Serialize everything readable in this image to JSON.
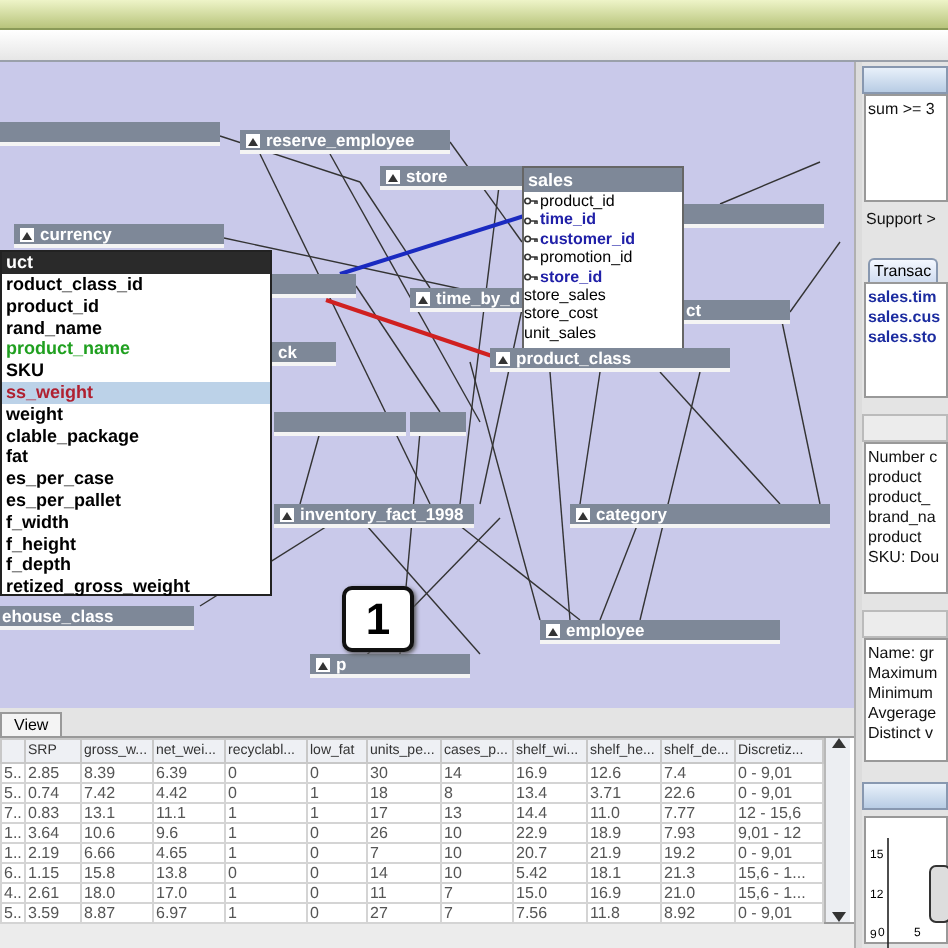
{
  "canvas": {
    "nodes": [
      {
        "kind": "bar"
      },
      {
        "kind": "table",
        "label": "reserve_employee"
      },
      {
        "kind": "table",
        "label": "store"
      },
      {
        "kind": "table",
        "label": "currency"
      },
      {
        "kind": "bar"
      },
      {
        "kind": "bar"
      },
      {
        "kind": "table",
        "label": "time_by_d"
      },
      {
        "kind": "plain",
        "label": "ck"
      },
      {
        "kind": "plain",
        "label": "ct"
      },
      {
        "kind": "bar"
      },
      {
        "kind": "bar"
      },
      {
        "kind": "table",
        "label": "inventory_fact_1998"
      },
      {
        "kind": "table",
        "label": "category"
      },
      {
        "kind": "table",
        "label": "employee"
      },
      {
        "kind": "plain",
        "label": "ehouse_class"
      },
      {
        "kind": "table",
        "label": "p"
      },
      {
        "kind": "table",
        "label": "product_class"
      }
    ],
    "sales": {
      "title": "sales",
      "fields": [
        {
          "name": "product_id",
          "key": true,
          "highlighted": false
        },
        {
          "name": "time_id",
          "key": true,
          "highlighted": true
        },
        {
          "name": "customer_id",
          "key": true,
          "highlighted": true
        },
        {
          "name": "promotion_id",
          "key": true,
          "highlighted": false
        },
        {
          "name": "store_id",
          "key": true,
          "highlighted": true
        },
        {
          "name": "store_sales",
          "key": false,
          "highlighted": false
        },
        {
          "name": "store_cost",
          "key": false,
          "highlighted": false
        },
        {
          "name": "unit_sales",
          "key": false,
          "highlighted": false
        }
      ]
    },
    "product_list": {
      "title": "uct",
      "fields": [
        {
          "name": "roduct_class_id",
          "color": "#000000",
          "selected": false
        },
        {
          "name": "product_id",
          "color": "#000000",
          "selected": false
        },
        {
          "name": "rand_name",
          "color": "#000000",
          "selected": false
        },
        {
          "name": "product_name",
          "color": "#20a020",
          "selected": false
        },
        {
          "name": "SKU",
          "color": "#000000",
          "selected": false
        },
        {
          "name": "ss_weight",
          "color": "#b02030",
          "selected": true
        },
        {
          "name": "weight",
          "color": "#000000",
          "selected": false
        },
        {
          "name": "clable_package",
          "color": "#000000",
          "selected": false
        },
        {
          "name": "fat",
          "color": "#000000",
          "selected": false
        },
        {
          "name": "es_per_case",
          "color": "#000000",
          "selected": false
        },
        {
          "name": "es_per_pallet",
          "color": "#000000",
          "selected": false
        },
        {
          "name": "f_width",
          "color": "#000000",
          "selected": false
        },
        {
          "name": "f_height",
          "color": "#000000",
          "selected": false
        },
        {
          "name": "f_depth",
          "color": "#000000",
          "selected": false
        },
        {
          "name": "retized_gross_weight",
          "color": "#000000",
          "selected": false
        }
      ]
    },
    "badge": "1"
  },
  "tabs": [
    {
      "label": "View",
      "selected": true
    }
  ],
  "table": {
    "columns": [
      "",
      "SRP",
      "gross_w...",
      "net_wei...",
      "recyclabl...",
      "low_fat",
      "units_pe...",
      "cases_p...",
      "shelf_wi...",
      "shelf_he...",
      "shelf_de...",
      "Discretiz..."
    ],
    "rows": [
      [
        "5..",
        "2.85",
        "8.39",
        "6.39",
        "0",
        "0",
        "30",
        "14",
        "16.9",
        "12.6",
        "7.4",
        "0 - 9,01"
      ],
      [
        "5..",
        "0.74",
        "7.42",
        "4.42",
        "0",
        "1",
        "18",
        "8",
        "13.4",
        "3.71",
        "22.6",
        "0 - 9,01"
      ],
      [
        "7..",
        "0.83",
        "13.1",
        "11.1",
        "1",
        "1",
        "17",
        "13",
        "14.4",
        "11.0",
        "7.77",
        "12 - 15,6"
      ],
      [
        "1..",
        "3.64",
        "10.6",
        "9.6",
        "1",
        "0",
        "26",
        "10",
        "22.9",
        "18.9",
        "7.93",
        "9,01 - 12"
      ],
      [
        "1..",
        "2.19",
        "6.66",
        "4.65",
        "1",
        "0",
        "7",
        "10",
        "20.7",
        "21.9",
        "19.2",
        "0 - 9,01"
      ],
      [
        "6..",
        "1.15",
        "15.8",
        "13.8",
        "0",
        "0",
        "14",
        "10",
        "5.42",
        "18.1",
        "21.3",
        "15,6 - 1..."
      ],
      [
        "4..",
        "2.61",
        "18.0",
        "17.0",
        "1",
        "0",
        "11",
        "7",
        "15.0",
        "16.9",
        "21.0",
        "15,6 - 1..."
      ],
      [
        "5..",
        "3.59",
        "8.87",
        "6.97",
        "1",
        "0",
        "27",
        "7",
        "7.56",
        "11.8",
        "8.92",
        "0 - 9,01"
      ]
    ]
  },
  "right_panel": {
    "rule": "sum >= 3",
    "support": "Support >",
    "tab": "Transac",
    "transactions": [
      "sales.tim",
      "sales.cus",
      "sales.sto"
    ],
    "summary": [
      "Number c",
      "product",
      "product_",
      "brand_na",
      "product",
      "SKU: Dou"
    ],
    "stats": [
      "Name: gr",
      "Maximum",
      "Minimum",
      "Avgerage",
      "Distinct v"
    ],
    "plot": {
      "y_ticks": [
        "15",
        "12",
        "9"
      ],
      "x_ticks": [
        "0",
        "5"
      ]
    }
  }
}
